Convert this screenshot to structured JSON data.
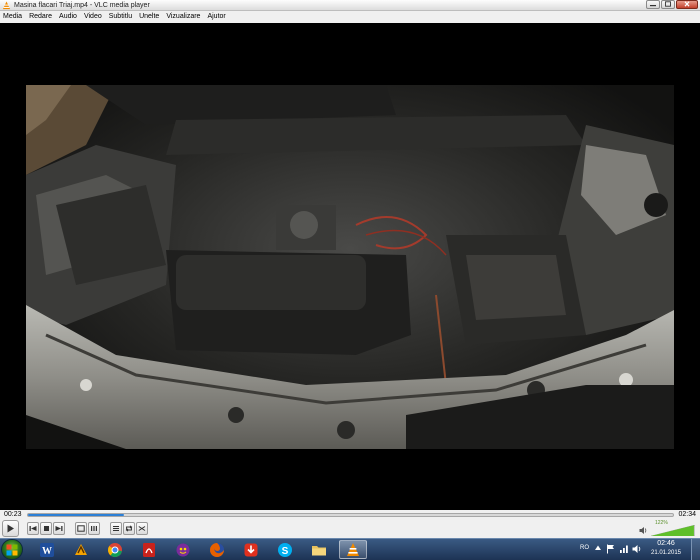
{
  "window": {
    "title": "Masina flacari Triaj.mp4 - VLC media player"
  },
  "menu": {
    "items": [
      "Media",
      "Redare",
      "Audio",
      "Video",
      "Subtitlu",
      "Unelte",
      "Vizualizare",
      "Ajutor"
    ]
  },
  "playback": {
    "elapsed": "00:23",
    "total": "02:34",
    "progress_fraction": 0.149
  },
  "volume": {
    "label": "122%",
    "level_percent": 122
  },
  "taskbar": {
    "apps": [
      "word-icon",
      "winamp-icon",
      "chrome-icon",
      "pdf-icon",
      "messenger-icon",
      "firefox-icon",
      "download-icon",
      "skype-icon",
      "folder-icon",
      "vlc-icon"
    ],
    "active_app": "vlc-icon"
  },
  "tray": {
    "language": "RO",
    "time": "02:46",
    "date": "21.01.2015"
  },
  "colors": {
    "accent": "#2c7fd6",
    "vlc_orange": "#f08a00",
    "volume_green": "#5fbf2a"
  }
}
